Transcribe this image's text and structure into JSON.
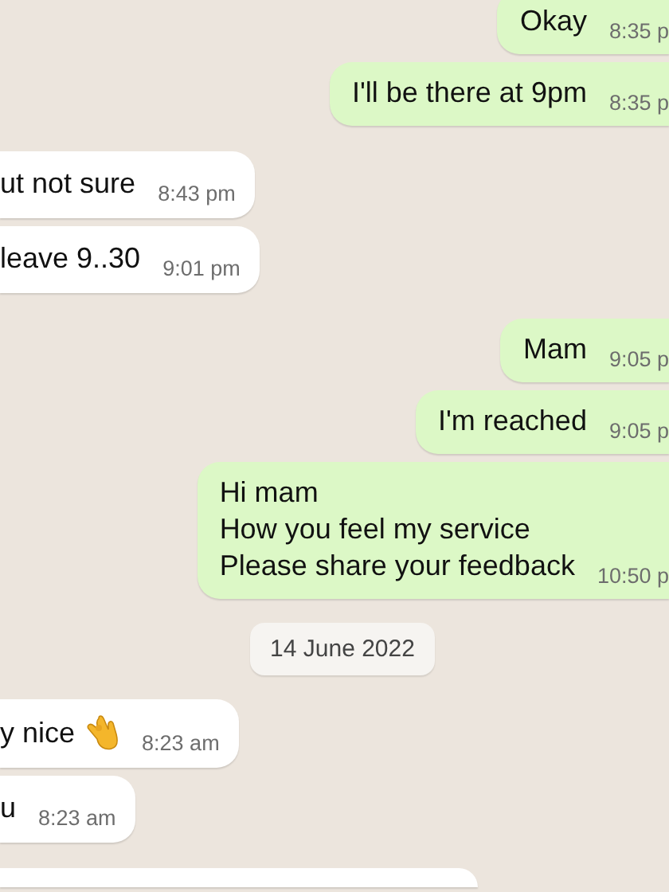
{
  "messages": [
    {
      "kind": "outgoing",
      "text": "Okay",
      "time": "8:35 p"
    },
    {
      "kind": "outgoing",
      "text": "I'll be there at 9pm",
      "time": "8:35 p"
    },
    {
      "kind": "incoming",
      "text": "ut not sure",
      "time": "8:43 pm"
    },
    {
      "kind": "incoming",
      "text": "leave 9..30",
      "time": "9:01 pm"
    },
    {
      "kind": "outgoing",
      "text": "Mam",
      "time": "9:05 p"
    },
    {
      "kind": "outgoing",
      "text": "I'm reached",
      "time": "9:05 p"
    },
    {
      "kind": "outgoing",
      "text": "Hi mam\nHow you feel my service\nPlease share your feedback",
      "time": "10:50 p"
    },
    {
      "kind": "date",
      "text": "14 June 2022"
    },
    {
      "kind": "incoming",
      "text": "y nice",
      "emoji": true,
      "time": "8:23 am"
    },
    {
      "kind": "incoming",
      "text": "u",
      "time": "8:23 am"
    },
    {
      "kind": "partial"
    }
  ]
}
